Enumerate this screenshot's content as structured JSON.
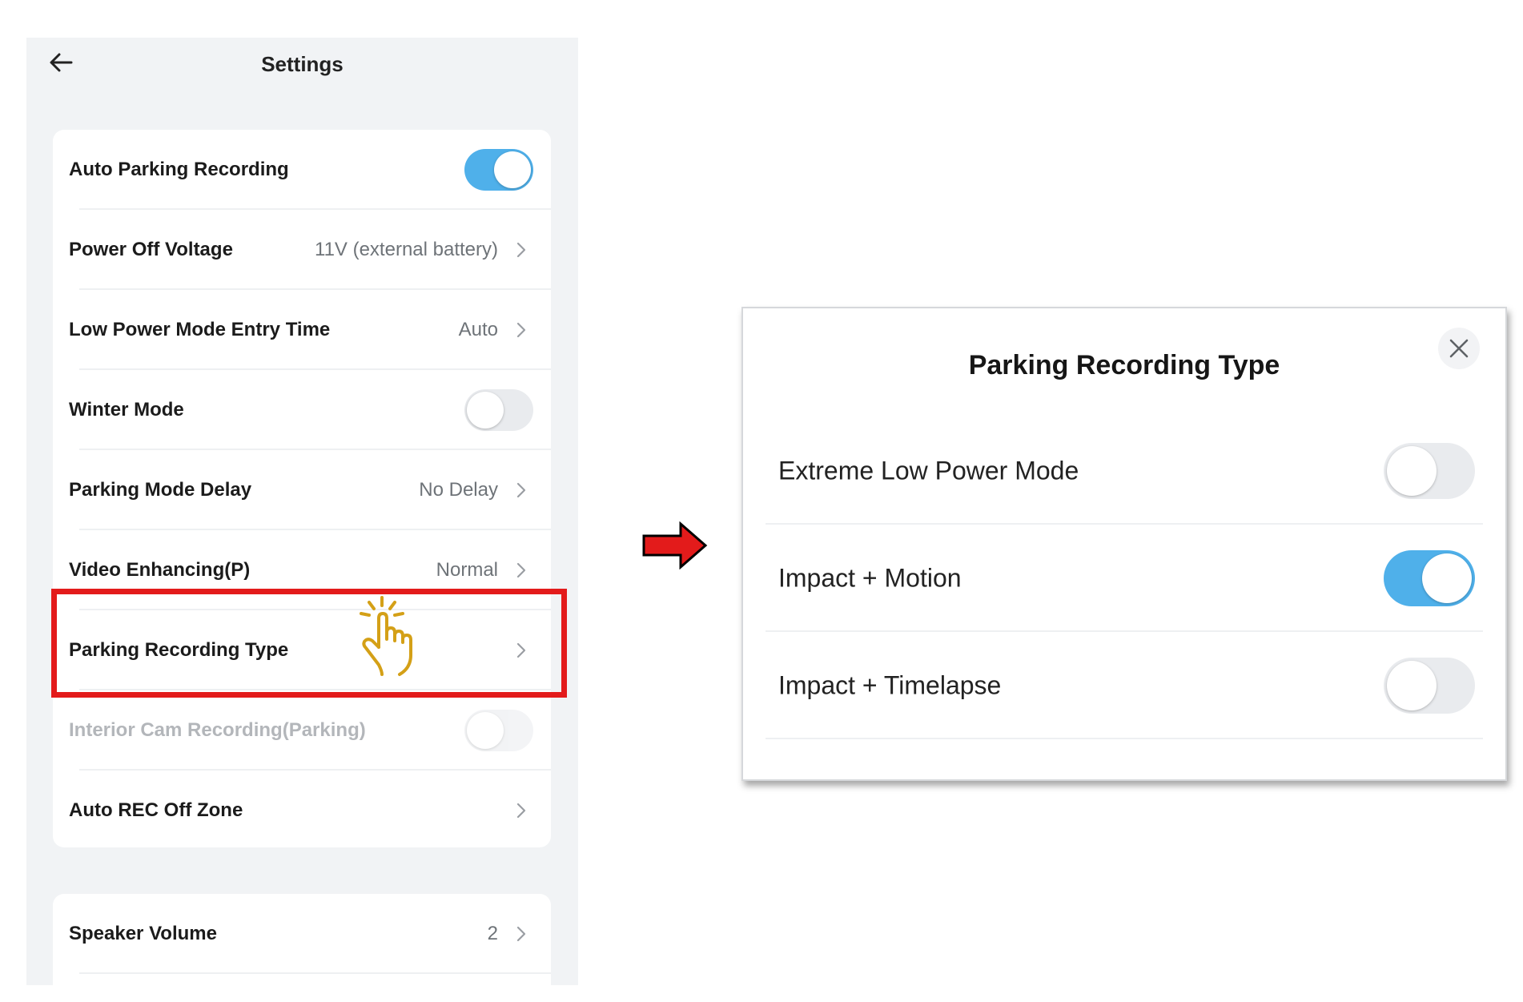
{
  "settings": {
    "title": "Settings",
    "rows": [
      {
        "label": "Auto Parking Recording",
        "toggle": "on"
      },
      {
        "label": "Power Off Voltage",
        "value": "11V (external battery)"
      },
      {
        "label": "Low Power Mode Entry Time",
        "value": "Auto"
      },
      {
        "label": "Winter Mode",
        "toggle": "off"
      },
      {
        "label": "Parking Mode Delay",
        "value": "No Delay"
      },
      {
        "label": "Video Enhancing(P)",
        "value": "Normal"
      },
      {
        "label": "Parking Recording Type",
        "value": ""
      },
      {
        "label": "Interior Cam Recording(Parking)",
        "toggle": "off",
        "disabled": true
      },
      {
        "label": "Auto REC Off Zone",
        "value": ""
      }
    ],
    "rows2": [
      {
        "label": "Speaker Volume",
        "value": "2"
      }
    ]
  },
  "dialog": {
    "title": "Parking Recording Type",
    "options": [
      {
        "label": "Extreme Low Power Mode",
        "toggle": "off"
      },
      {
        "label": "Impact + Motion",
        "toggle": "on"
      },
      {
        "label": "Impact + Timelapse",
        "toggle": "off"
      }
    ]
  },
  "colors": {
    "toggle_on": "#4fb0ea",
    "highlight": "#e31b1b",
    "hand": "#d4a017"
  },
  "icons": [
    "back-arrow-icon",
    "chevron-right-icon",
    "tap-hand-icon",
    "right-arrow-icon",
    "close-icon"
  ]
}
